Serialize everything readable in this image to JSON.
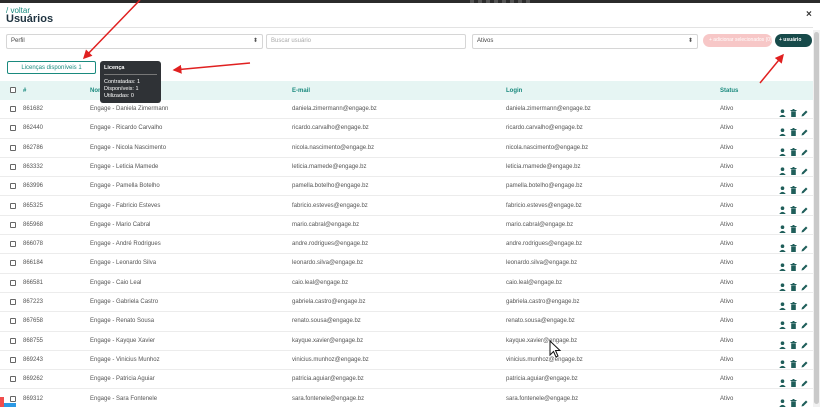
{
  "header": {
    "back_label": "/ voltar",
    "title": "Usuários",
    "close_label": "×"
  },
  "filters": {
    "profile_value": "Perfil",
    "search_placeholder": "Buscar usuário",
    "status_value": "Ativos",
    "bulk_button_label": "+ adicionar selecionados (0)",
    "new_button_label": "+ usuário"
  },
  "licenses": {
    "button_label": "Licenças disponíveis 1",
    "tooltip": {
      "title": "Licença",
      "contracted": "Contratadas: 1",
      "available": "Disponíveis: 1",
      "used": "Utilizadas: 0"
    }
  },
  "table": {
    "columns": [
      "#",
      "Nome",
      "E-mail",
      "Login",
      "Status"
    ],
    "rows": [
      [
        "861682",
        "Engage - Daniela Zimermann",
        "daniela.zimermann@engage.bz",
        "daniela.zimermann@engage.bz",
        "Ativo"
      ],
      [
        "862440",
        "Engage - Ricardo Carvalho",
        "ricardo.carvalho@engage.bz",
        "ricardo.carvalho@engage.bz",
        "Ativo"
      ],
      [
        "862786",
        "Engage - Nicola Nascimento",
        "nicola.nascimento@engage.bz",
        "nicola.nascimento@engage.bz",
        "Ativo"
      ],
      [
        "863332",
        "Engage - Leticia Mamede",
        "leticia.mamede@engage.bz",
        "leticia.mamede@engage.bz",
        "Ativo"
      ],
      [
        "863996",
        "Engage - Pamella Botelho",
        "pamella.botelho@engage.bz",
        "pamella.botelho@engage.bz",
        "Ativo"
      ],
      [
        "865325",
        "Engage - Fabricio Esteves",
        "fabricio.esteves@engage.bz",
        "fabricio.esteves@engage.bz",
        "Ativo"
      ],
      [
        "865968",
        "Engage - Mario Cabral",
        "mario.cabral@engage.bz",
        "mario.cabral@engage.bz",
        "Ativo"
      ],
      [
        "866078",
        "Engage - André Rodrigues",
        "andre.rodrigues@engage.bz",
        "andre.rodrigues@engage.bz",
        "Ativo"
      ],
      [
        "866184",
        "Engage - Leonardo Silva",
        "leonardo.silva@engage.bz",
        "leonardo.silva@engage.bz",
        "Ativo"
      ],
      [
        "866581",
        "Engage - Caio Leal",
        "caio.leal@engage.bz",
        "caio.leal@engage.bz",
        "Ativo"
      ],
      [
        "867223",
        "Engage - Gabriela Castro",
        "gabriela.castro@engage.bz",
        "gabriela.castro@engage.bz",
        "Ativo"
      ],
      [
        "867658",
        "Engage - Renato Sousa",
        "renato.sousa@engage.bz",
        "renato.sousa@engage.bz",
        "Ativo"
      ],
      [
        "868755",
        "Engage - Kayque Xavier",
        "kayque.xavier@engage.bz",
        "kayque.xavier@engage.bz",
        "Ativo"
      ],
      [
        "869243",
        "Engage - Vinicius Munhoz",
        "vinicius.munhoz@engage.bz",
        "vinicius.munhoz@engage.bz",
        "Ativo"
      ],
      [
        "869262",
        "Engage - Patricia Aguiar",
        "patricia.aguiar@engage.bz",
        "patricia.aguiar@engage.bz",
        "Ativo"
      ],
      [
        "869312",
        "Engage - Sara Fontenele",
        "sara.fontenele@engage.bz",
        "sara.fontenele@engage.bz",
        "Ativo"
      ]
    ]
  },
  "colors": {
    "accent": "#1a8a7e",
    "dark_button": "#174a4a",
    "disabled_button": "#f7c7c7",
    "annotation_arrow": "#e02020"
  },
  "icons": {
    "row_actions": [
      "user-icon",
      "trash-icon",
      "pencil-icon"
    ]
  }
}
